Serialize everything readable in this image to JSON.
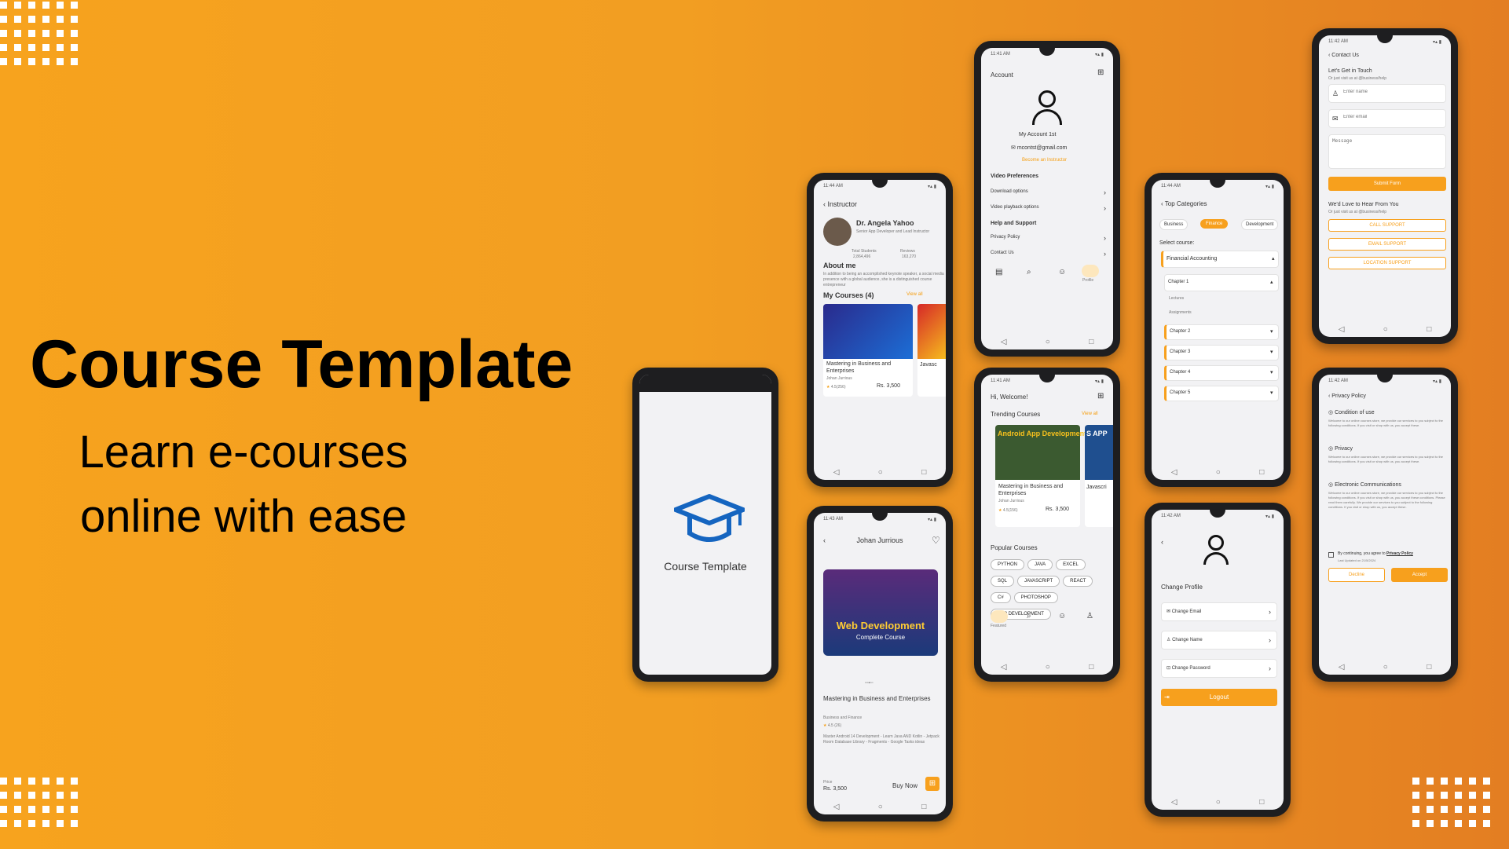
{
  "hero": {
    "title": "Course Template",
    "subtitle_line1": "Learn e-courses",
    "subtitle_line2": "online with ease"
  },
  "colors": {
    "accent": "#f7a01d",
    "brand_blue": "#1565c0",
    "background_start": "#f7a31e",
    "background_end": "#e37e22"
  },
  "splash": {
    "app_name": "Course Template",
    "icon": "graduation-cap-icon"
  },
  "instructor": {
    "time": "11:44 AM",
    "back_title": "Instructor",
    "name": "Dr. Angela Yahoo",
    "role": "Senior App Developer and Lead Instructor",
    "students_label": "Total Students",
    "students_value": "2,864,496",
    "reviews_label": "Reviews",
    "reviews_value": "163,270",
    "about_title": "About me",
    "about_text": "In addition to being an accomplished keynote speaker, a social media presence with a global audience, she is a distinguished course entrepreneur",
    "my_courses": "My Courses (4)",
    "view_all": "View all",
    "course1_title": "Mastering in Business and Enterprises",
    "course1_author": "Johan Jurrious",
    "course1_rating": "4.5(256)",
    "course1_price": "Rs. 3,500",
    "course2_title": "Javasc"
  },
  "account": {
    "time": "11:41 AM",
    "title": "Account",
    "user": "My Account 1st",
    "email": "mcontst@gmail.com",
    "become": "Become an Instructor",
    "sec_video": "Video Preferences",
    "download": "Download options",
    "playback": "Video playback options",
    "sec_help": "Help and Support",
    "privacy": "Privacy Policy",
    "contact": "Contact Us",
    "nav_profile": "Profile"
  },
  "home": {
    "time": "11:41 AM",
    "welcome": "Hi, Welcome!",
    "trending": "Trending Courses",
    "view_all": "View all",
    "card_title": "Mastering in Business and Enterprises",
    "card_author": "Johan Jurrious",
    "card_rating": "4.5(156)",
    "card_price": "Rs. 3,500",
    "card_banner": "Android App Development",
    "card2_title": "Javascri",
    "card2_banner": "S APP",
    "popular": "Popular Courses",
    "tags": [
      "PYTHON",
      "JAVA",
      "EXCEL",
      "SQL",
      "JAVASCRIPT",
      "REACT",
      "C#",
      "PHOTOSHOP",
      "APP DEVELOPMENT"
    ],
    "nav_featured": "Featured"
  },
  "detail": {
    "time": "11:43 AM",
    "author": "Johan Jurrious",
    "banner_top": "Web Development",
    "banner_sub": "Complete Course",
    "title": "Mastering in Business and Enterprises",
    "category": "Business and Finance",
    "rating": "4.5 (26)",
    "desc": "Master Android 14 Development - Learn Java AND Kotlin - Jetpack Room Database Library - Fragments - Google Tasks ideas",
    "price_label": "Price",
    "price": "Rs. 3,500",
    "buy": "Buy Now"
  },
  "categories": {
    "time": "11:44 AM",
    "title": "Top Categories",
    "tabs": [
      "Business",
      "Finance",
      "Development"
    ],
    "select": "Select course:",
    "course": "Financial Accounting",
    "chapter1": "Chapter 1",
    "lectures": "Lectures",
    "assignments": "Assignments",
    "chapters": [
      "Chapter 2",
      "Chapter 3",
      "Chapter 4",
      "Chapter 5"
    ]
  },
  "profile": {
    "time": "11:42 AM",
    "title": "Change Profile",
    "email": "Change Email",
    "name": "Change Name",
    "password": "Change Password",
    "logout": "Logout"
  },
  "contact": {
    "time": "11:42 AM",
    "title": "Contact Us",
    "heading": "Let's Get in Touch",
    "sub": "Or just visit us at @business/help",
    "name_ph": "Enter name",
    "email_ph": "Enter email",
    "message_ph": "Message",
    "submit": "Submit Form",
    "love": "We'd Love to Hear From You",
    "love_sub": "Or just visit us at @business/help",
    "call": "CALL SUPPORT",
    "email_support": "EMAIL SUPPORT",
    "location": "LOCATION SUPPORT"
  },
  "privacy": {
    "time": "11:42 AM",
    "title": "Privacy Policy",
    "s1": "Condition of use",
    "t1": "Welcome to our online courses store, we provide our services to you subject to the following conditions. If you visit or shop with us, you accept these.",
    "s2": "Privacy",
    "t2": "Welcome to our online courses store, we provide our services to you subject to the following conditions. If you visit or shop with us, you accept these.",
    "s3": "Electronic Communications",
    "t3": "Welcome to our online courses store, we provide our services to you subject to the following conditions. If you visit or shop with us, you accept these conditions. Please read them carefully. We provide our services to you subject to the following conditions. If you visit or shop with us, you accept these.",
    "agree": "By continuing, you agree to",
    "agree_link": "Privacy Policy",
    "updated": "Last Updated on 21/5/2024",
    "decline": "Decline",
    "accept": "Accept"
  }
}
